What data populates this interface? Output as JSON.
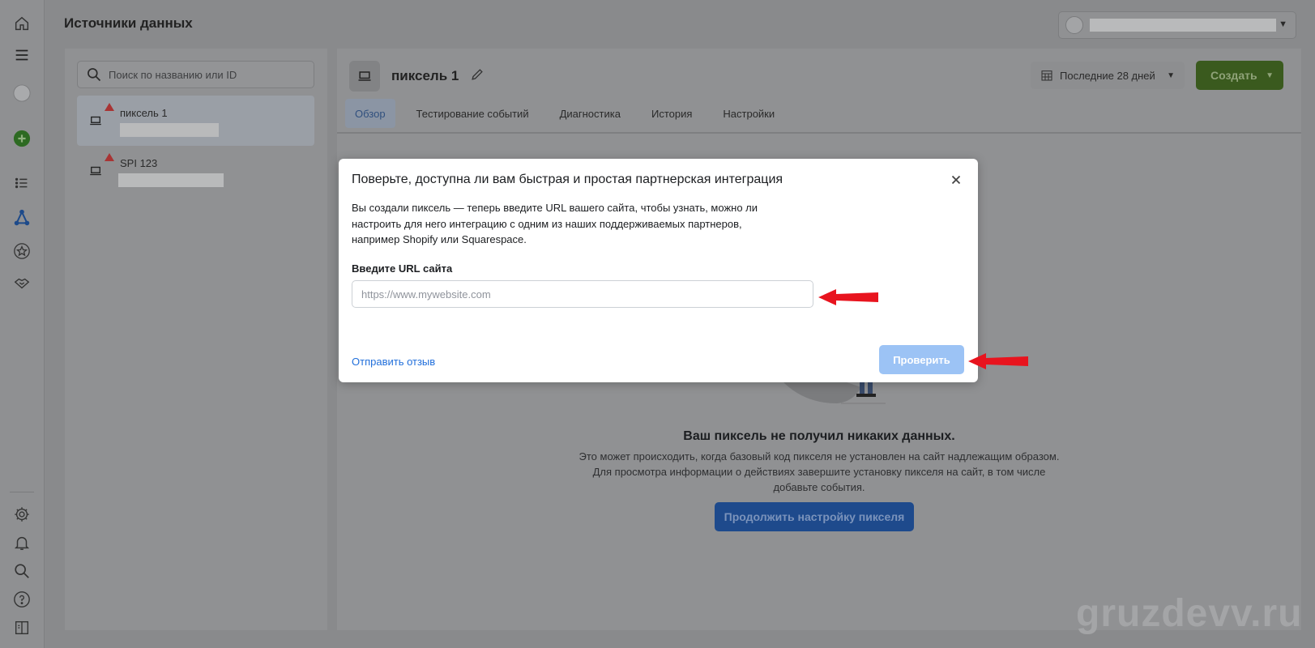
{
  "header": {
    "title": "Источники данных"
  },
  "rail": {
    "icons": [
      "home-icon",
      "menu-icon",
      "account-avatar-icon",
      "add-icon",
      "list-icon",
      "events-manager-icon",
      "star-icon",
      "handshake-icon",
      "gear-icon",
      "bell-icon",
      "search-icon",
      "help-icon",
      "sidebar-icon"
    ]
  },
  "search": {
    "placeholder": "Поиск по названию или ID"
  },
  "pixels": [
    {
      "name": "пиксель 1",
      "selected": true,
      "warning": true
    },
    {
      "name": "SPI 123",
      "selected": false,
      "warning": true
    }
  ],
  "main": {
    "pixel_name": "пиксель 1",
    "date_range": "Последние 28 дней",
    "create_label": "Создать",
    "tabs": [
      {
        "label": "Обзор",
        "active": true
      },
      {
        "label": "Тестирование событий",
        "active": false
      },
      {
        "label": "Диагностика",
        "active": false
      },
      {
        "label": "История",
        "active": false
      },
      {
        "label": "Настройки",
        "active": false
      }
    ],
    "empty_title": "Ваш пиксель не получил никаких данных.",
    "empty_desc": "Это может происходить, когда базовый код пикселя не установлен на сайт надлежащим образом. Для просмотра информации о действиях завершите установку пикселя на сайт, в том числе добавьте события.",
    "continue_label": "Продолжить настройку пикселя"
  },
  "modal": {
    "title": "Поверьте, доступна ли вам быстрая и простая партнерская интеграция",
    "description": "Вы создали пиксель — теперь введите URL вашего сайта, чтобы узнать, можно ли настроить для него интеграцию с одним из наших поддерживаемых партнеров, например Shopify или Squarespace.",
    "url_label": "Введите URL сайта",
    "url_placeholder": "https://www.mywebsite.com",
    "url_value": "",
    "feedback_label": "Отправить отзыв",
    "verify_label": "Проверить"
  },
  "colors": {
    "primary": "#1877f2",
    "create_green": "#42b72a",
    "warning_red": "#fa383e",
    "annotation_arrow": "#e8141e"
  },
  "watermark": "gruzdevv.ru"
}
